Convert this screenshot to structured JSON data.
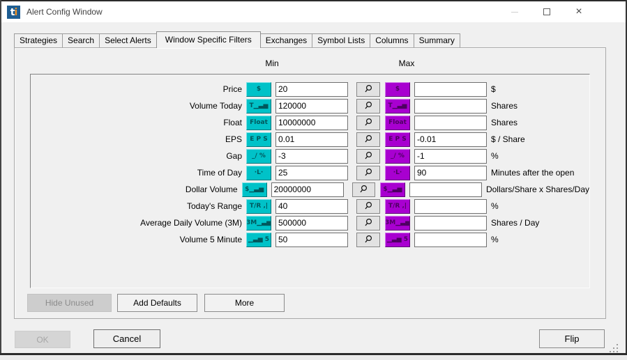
{
  "window": {
    "title": "Alert Config Window",
    "app_icon": {
      "name": "trade-ideas-logo",
      "t": "t",
      "i": "i",
      "bg_color": "#1d5d92",
      "i_color": "#ee9127"
    },
    "controls": {
      "minimize": "minimize-icon",
      "maximize": "maximize-icon",
      "close": "close-icon",
      "close_glyph": "×"
    }
  },
  "tabs": [
    {
      "label": "Strategies",
      "active": false
    },
    {
      "label": "Search",
      "active": false
    },
    {
      "label": "Select Alerts",
      "active": false
    },
    {
      "label": "Window Specific Filters",
      "active": true
    },
    {
      "label": "Exchanges",
      "active": false
    },
    {
      "label": "Symbol Lists",
      "active": false
    },
    {
      "label": "Columns",
      "active": false
    },
    {
      "label": "Summary",
      "active": false
    }
  ],
  "headers": {
    "min": "Min",
    "max": "Max"
  },
  "colors": {
    "min_accent": "#00c2c8",
    "max_accent": "#a800d0"
  },
  "rows": [
    {
      "label": "Price",
      "icon": "price-icon",
      "glyph": "$",
      "min": "20",
      "max": "",
      "unit": "$"
    },
    {
      "label": "Volume Today",
      "icon": "volume-today-icon",
      "glyph": "T▁▃▅",
      "min": "120000",
      "max": "",
      "unit": "Shares"
    },
    {
      "label": "Float",
      "icon": "float-icon",
      "glyph": "Float",
      "min": "10000000",
      "max": "",
      "unit": "Shares"
    },
    {
      "label": "EPS",
      "icon": "eps-icon",
      "glyph": "E P S",
      "min": "0.01",
      "max": "-0.01",
      "unit": "$ / Share"
    },
    {
      "label": "Gap",
      "icon": "gap-icon",
      "glyph": "_/ %",
      "min": "-3",
      "max": "-1",
      "unit": "%"
    },
    {
      "label": "Time of Day",
      "icon": "time-of-day-icon",
      "glyph": "·L·",
      "min": "25",
      "max": "90",
      "unit": "Minutes after the open"
    },
    {
      "label": "Dollar Volume",
      "icon": "dollar-volume-icon",
      "glyph": "$▁▃▅",
      "min": "20000000",
      "max": "",
      "unit": "Dollars/Share x Shares/Day"
    },
    {
      "label": "Today's Range",
      "icon": "todays-range-icon",
      "glyph": "T/R ‚|",
      "min": "40",
      "max": "",
      "unit": "%"
    },
    {
      "label": "Average Daily Volume (3M)",
      "icon": "avg-daily-volume-icon",
      "glyph": "3M▁▃▅",
      "min": "500000",
      "max": "",
      "unit": "Shares / Day"
    },
    {
      "label": "Volume 5 Minute",
      "icon": "volume-5-minute-icon",
      "glyph": "▁▃▅ 5",
      "min": "50",
      "max": "",
      "unit": "%"
    }
  ],
  "footer_buttons": {
    "hide_unused": "Hide Unused",
    "add_defaults": "Add Defaults",
    "more": "More"
  },
  "dialog_buttons": {
    "ok": "OK",
    "cancel": "Cancel",
    "flip": "Flip"
  }
}
